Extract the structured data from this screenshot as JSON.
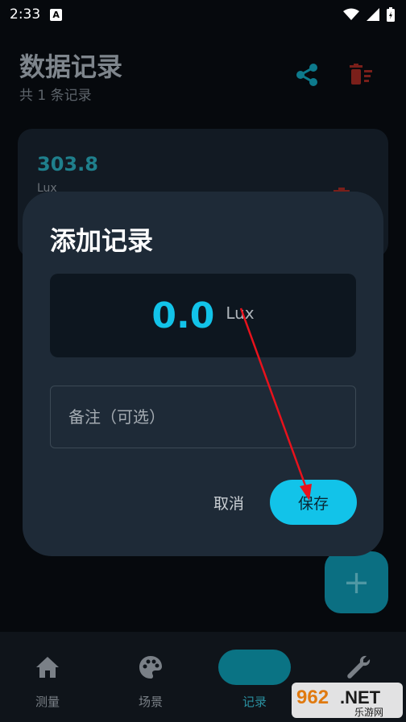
{
  "status_bar": {
    "time": "2:33",
    "notif_letter": "A"
  },
  "header": {
    "title": "数据记录",
    "subtitle": "共 1 条记录"
  },
  "record": {
    "value": "303.8",
    "unit": "Lux"
  },
  "fab": {
    "symbol": "+"
  },
  "nav": {
    "items": [
      {
        "label": "测量",
        "icon": "home-icon"
      },
      {
        "label": "场景",
        "icon": "palette-icon"
      },
      {
        "label": "记录",
        "icon": "list-icon",
        "active": true
      },
      {
        "label": "",
        "icon": "wrench-icon"
      }
    ]
  },
  "dialog": {
    "title": "添加记录",
    "value": "0.0",
    "unit": "Lux",
    "note_placeholder": "备注（可选）",
    "cancel_label": "取消",
    "save_label": "保存"
  },
  "colors": {
    "accent": "#12c3e9",
    "dialog_bg": "#1e2a37",
    "danger": "#c0392b",
    "annotation": "#e8121c"
  },
  "watermark": {
    "text": "962.NET",
    "subtext": "乐游网"
  }
}
